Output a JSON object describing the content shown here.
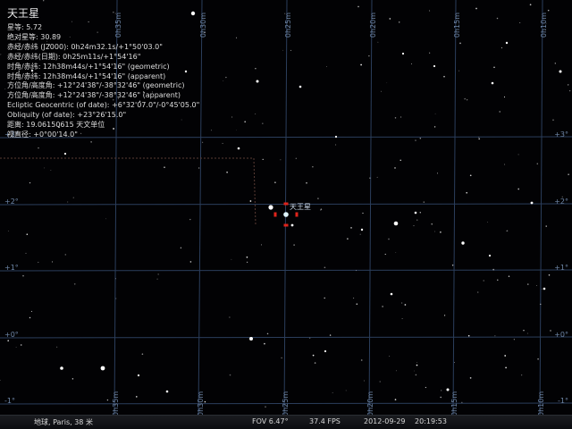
{
  "object": {
    "title": "天王星",
    "lines": [
      "星等: 5.72",
      "绝对星等: 30.89",
      "赤经/赤纬 (J2000): 0h24m32.1s/+1°50'03.0\"",
      "赤经/赤纬(日期): 0h25m11s/+1°54'16\"",
      "时角/赤纬: 12h38m44s/+1°54'16\" (geometric)",
      "时角/赤纬: 12h38m44s/+1°54'16\" (apparent)",
      "方位角/高度角: +12°24'38\"/-38°32'46\" (geometric)",
      "方位角/高度角: +12°24'38\"/-38°32'46\" (apparent)",
      "Ecliptic Geocentric (of date): +6°32'07.0\"/-0°45'05.0\"",
      "Obliquity (of date): +23°26'15.0\"",
      "距离: 19.06150615 天文单位",
      "视直径: +0°00'14.0\""
    ],
    "marker_label": "天王星"
  },
  "grid": {
    "ra_labels": [
      "0h35m",
      "0h30m",
      "0h25m",
      "0h20m",
      "0h15m",
      "0h10m"
    ],
    "dec_labels": [
      "+3°",
      "+2°",
      "+1°",
      "+0°",
      "-1°"
    ]
  },
  "status": {
    "location": "地球, Paris, 38 米",
    "fov": "FOV 6.47°",
    "fps": "37.4 FPS",
    "date": "2012-09-29",
    "time": "20:19:53"
  },
  "colors": {
    "background": "#020204",
    "grid": "#2b3e5c",
    "grid_label": "#6f87a8",
    "boundary": "#5a3c35",
    "pointer": "#e0241b",
    "star": "#ffffff"
  }
}
